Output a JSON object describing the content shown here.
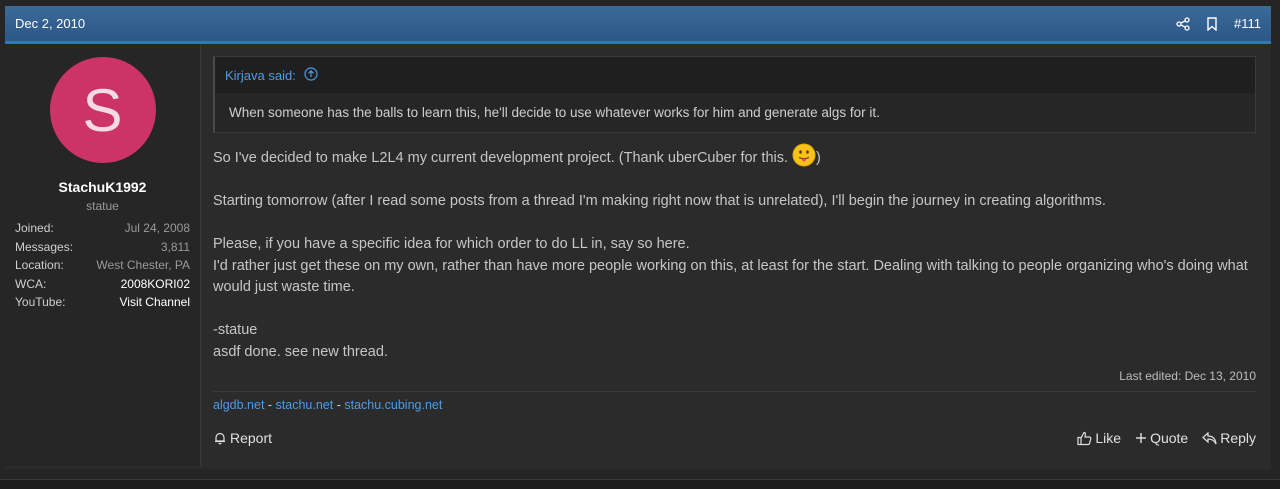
{
  "header": {
    "date": "Dec 2, 2010",
    "post_number": "#111",
    "share_icon": "share-icon",
    "bookmark_icon": "bookmark-icon"
  },
  "user": {
    "avatar_letter": "S",
    "avatar_color": "#cc3366",
    "username": "StachuK1992",
    "title": "statue",
    "stats": [
      {
        "label": "Joined:",
        "value": "Jul 24, 2008"
      },
      {
        "label": "Messages:",
        "value": "3,811"
      },
      {
        "label": "Location:",
        "value": "West Chester, PA"
      },
      {
        "label": "WCA:",
        "value": "2008KORI02"
      },
      {
        "label": "YouTube:",
        "value": "Visit Channel"
      }
    ]
  },
  "quote": {
    "author": "Kirjava said:",
    "text": "When someone has the balls to learn this, he'll decide to use whatever works for him and generate algs for it."
  },
  "message": {
    "line1_before": "So I've decided to make L2L4 my current development project. (Thank uberCuber for this.",
    "line1_after": ")",
    "line2": "Starting tomorrow (after I read some posts from a thread I'm making right now that is unrelated), I'll begin the journey in creating algorithms.",
    "line3": "Please, if you have a specific idea for which order to do LL in, say so here.",
    "line4": "I'd rather just get these on my own, rather than have more people working on this, at least for the start. Dealing with talking to people organizing who's doing what would just waste time.",
    "line5": "-statue",
    "line6": "asdf done. see new thread."
  },
  "edited": "Last edited: Dec 13, 2010",
  "signature": {
    "link1": "algdb.net",
    "link2": "stachu.net",
    "link3": "stachu.cubing.net",
    "separator": " - "
  },
  "footer": {
    "report": "Report",
    "like": "Like",
    "quote": "Quote",
    "reply": "Reply"
  },
  "colors": {
    "accent": "#2f76c4",
    "link": "#4d9be6",
    "header": "#2c5787"
  }
}
